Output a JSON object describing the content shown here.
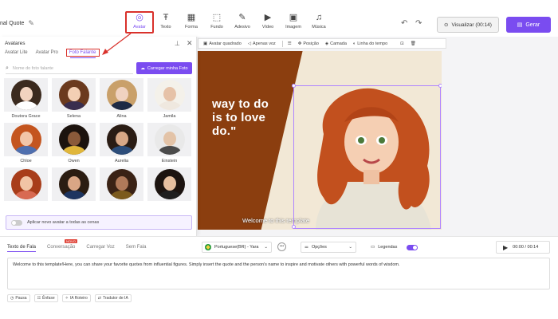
{
  "app": {
    "doc_title": "nal Quote",
    "toolbar": [
      {
        "label": "Avatar",
        "icon": "user-circle-icon",
        "glyph": "◎",
        "active": true
      },
      {
        "label": "Texto",
        "icon": "text-icon",
        "glyph": "Ŧ",
        "active": false
      },
      {
        "label": "Forma",
        "icon": "shapes-icon",
        "glyph": "▦",
        "active": false
      },
      {
        "label": "Fundo",
        "icon": "background-icon",
        "glyph": "⬚",
        "active": false
      },
      {
        "label": "Adesivo",
        "icon": "sticker-icon",
        "glyph": "✎",
        "active": false
      },
      {
        "label": "Vídeo",
        "icon": "video-icon",
        "glyph": "▶",
        "active": false
      },
      {
        "label": "Imagem",
        "icon": "image-icon",
        "glyph": "▣",
        "active": false
      },
      {
        "label": "Música",
        "icon": "music-icon",
        "glyph": "♫",
        "active": false
      }
    ],
    "preview_label": "Visualizar (00:14)",
    "generate_label": "Gerar"
  },
  "context_bar": {
    "avatar_shape": "Avatar quadrado",
    "voice_only": "Apenas voz",
    "position": "Posição",
    "layer": "Camada",
    "timeline": "Linha do tempo"
  },
  "slide": {
    "quote_lines": [
      "way to do",
      "is to love",
      "do.\""
    ],
    "caption": "Welcome to this template",
    "colors": {
      "brown": "#8b3e0f",
      "cream": "#f2e8d6"
    }
  },
  "panel": {
    "title": "Avatares",
    "tabs": [
      "Avatar Lite",
      "Avatar Pro",
      "Foto Falante"
    ],
    "active_tab": "Foto Falante",
    "search_placeholder": "Nome do foto falante",
    "upload_label": "Carregar minha Foto",
    "avatars": [
      {
        "name": "Doutora Grace",
        "skin": "#f1d3bf",
        "hair": "#3b2a1e",
        "cloth": "#ffffff"
      },
      {
        "name": "Selena",
        "skin": "#f3cfb4",
        "hair": "#6b3a1e",
        "cloth": "#3a2e4e"
      },
      {
        "name": "Alina",
        "skin": "#f0d2c0",
        "hair": "#c9a06a",
        "cloth": "#1e2a44"
      },
      {
        "name": "Jamila",
        "skin": "#e6c2a8",
        "hair": "#f4f1ea",
        "cloth": "#efe8df"
      },
      {
        "name": "Chloe",
        "skin": "#f2c6a8",
        "hair": "#c4551f",
        "cloth": "#4f6fae"
      },
      {
        "name": "Owen",
        "skin": "#8a5a3a",
        "hair": "#1c130e",
        "cloth": "#e0b63b"
      },
      {
        "name": "Aurelia",
        "skin": "#d8a887",
        "hair": "#2a1c14",
        "cloth": "#2c4d7a"
      },
      {
        "name": "Einstein",
        "skin": "#e3c3a7",
        "hair": "#e9e9e9",
        "cloth": "#4a4a4a"
      },
      {
        "name": "",
        "skin": "#f1c4a5",
        "hair": "#a83d1a",
        "cloth": "#d86a52"
      },
      {
        "name": "",
        "skin": "#d9a685",
        "hair": "#2b1d12",
        "cloth": "#1e3560"
      },
      {
        "name": "",
        "skin": "#b07a5a",
        "hair": "#3a2215",
        "cloth": "#7b5a1e"
      },
      {
        "name": "",
        "skin": "#e6c0a0",
        "hair": "#1c1410",
        "cloth": "#1f1f1f"
      }
    ],
    "apply_all_label": "Aplicar novo avatar a todas as cenas"
  },
  "bottom": {
    "tabs": [
      "Texto de Fala",
      "Conversação",
      "Carregar Voz",
      "Sem Fala"
    ],
    "active_tab": "Texto de Fala",
    "new_badge": "NOVO",
    "language": "Portuguese(BR) - Yara",
    "options": "Opções",
    "subtitles": "Legendas",
    "time": "00:00 / 00:14",
    "script": "Welcome to this template!Here, you can share your favorite quotes from influential figures. Simply insert the quote and the person's name to inspire and motivate others with powerful words of wisdom.",
    "actions": [
      "Pausa",
      "Ênfase",
      "IA Roteiro",
      "Tradutor de IA"
    ]
  }
}
